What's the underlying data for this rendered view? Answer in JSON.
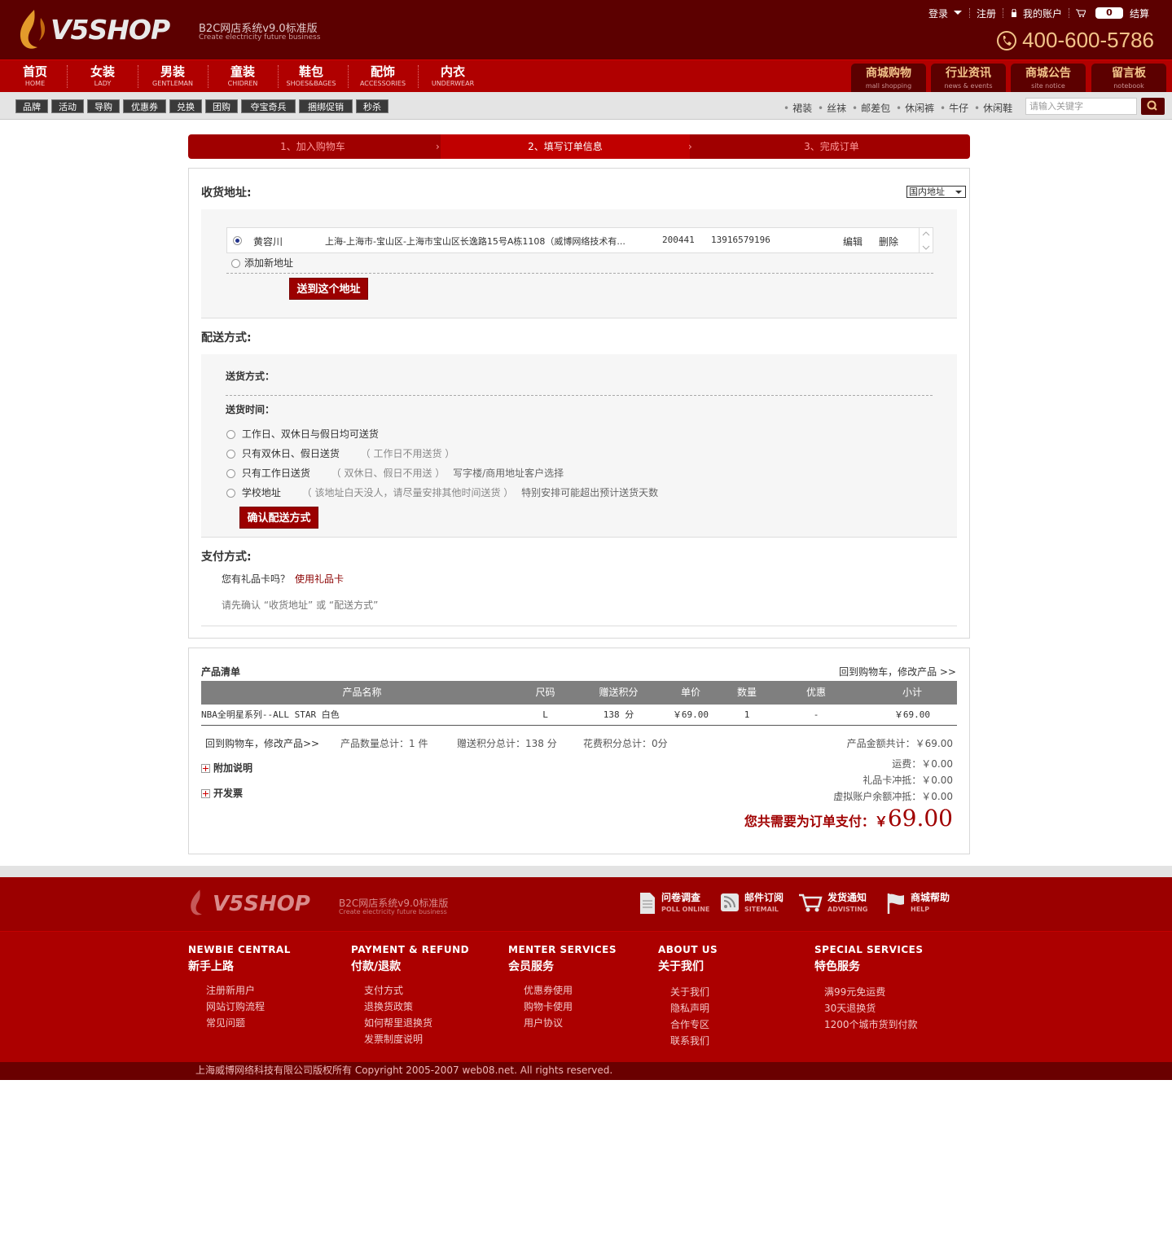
{
  "header": {
    "logo_text": "V5SHOP",
    "logo_sub_cn": "B2C网店系统v9.0标准版",
    "logo_sub_en": "Create electricity future business",
    "login": "登录",
    "register": "注册",
    "my_account": "我的账户",
    "cart_count": "0",
    "checkout": "结算",
    "phone": "400-600-5786"
  },
  "nav": {
    "items": [
      {
        "cn": "首页",
        "en": "HOME"
      },
      {
        "cn": "女装",
        "en": "LADY"
      },
      {
        "cn": "男装",
        "en": "GENTLEMAN"
      },
      {
        "cn": "童装",
        "en": "CHIDREN"
      },
      {
        "cn": "鞋包",
        "en": "SHOES&BAGES"
      },
      {
        "cn": "配饰",
        "en": "ACCESSORIES"
      },
      {
        "cn": "内衣",
        "en": "UNDERWEAR"
      }
    ],
    "right": [
      {
        "cn": "商城购物",
        "en": "mall shopping"
      },
      {
        "cn": "行业资讯",
        "en": "news & events"
      },
      {
        "cn": "商城公告",
        "en": "site notice"
      },
      {
        "cn": "留言板",
        "en": "notebook"
      }
    ]
  },
  "subbar": {
    "tags": [
      "品牌",
      "活动",
      "导购",
      "优惠券",
      "兑换",
      "团购",
      "夺宝奇兵",
      "捆绑促销",
      "秒杀"
    ],
    "hot": [
      "裙装",
      "丝袜",
      "邮差包",
      "休闲裤",
      "牛仔",
      "休闲鞋"
    ],
    "search_placeholder": "请输入关键字"
  },
  "steps": [
    "1、加入购物车",
    "2、填写订单信息",
    "3、完成订单"
  ],
  "address": {
    "title": "收货地址:",
    "select_value": "国内地址",
    "row": {
      "name": "黄容川",
      "addr": "上海-上海市-宝山区-上海市宝山区长逸路15号A栋1108（威博网络技术有...",
      "zip": "200441",
      "phone": "13916579196",
      "edit": "编辑",
      "delete": "删除"
    },
    "add_new": "添加新地址",
    "send_btn": "送到这个地址"
  },
  "delivery": {
    "title": "配送方式:",
    "method_label": "送货方式：",
    "time_label": "送货时间：",
    "options": [
      {
        "label": "工作日、双休日与假日均可送货",
        "note": "",
        "extra": ""
      },
      {
        "label": "只有双休日、假日送货",
        "note": "（ 工作日不用送货 ）",
        "extra": ""
      },
      {
        "label": "只有工作日送货",
        "note": "（ 双休日、假日不用送 ）",
        "extra": "写字楼/商用地址客户选择"
      },
      {
        "label": "学校地址",
        "note": "（ 该地址白天没人，请尽量安排其他时间送货 ）",
        "extra": "特别安排可能超出预计送货天数"
      }
    ],
    "confirm_btn": "确认配送方式"
  },
  "payment": {
    "title": "支付方式:",
    "gift_q": "您有礼品卡吗？",
    "gift_link": "使用礼品卡",
    "hint": "请先确认 “收货地址” 或 “配送方式”"
  },
  "products": {
    "title": "产品清单",
    "back_link": "回到购物车，修改产品 >>",
    "columns": [
      "产品名称",
      "尺码",
      "赠送积分",
      "单价",
      "数量",
      "优惠",
      "小计"
    ],
    "rows": [
      {
        "name": "NBA全明星系列--ALL STAR 白色",
        "size": "L",
        "points": "138 分",
        "price": "￥69.00",
        "qty": "1",
        "discount": "-",
        "subtotal": "￥69.00"
      }
    ],
    "summary": {
      "back": "回到购物车，修改产品>>",
      "count": "产品数量总计：1 件",
      "gift_points": "赠送积分总计：138 分",
      "spent_points": "花费积分总计：0分",
      "amount": "产品金额共计：￥69.00"
    },
    "attach": "附加说明",
    "invoice": "开发票",
    "fees": [
      "运费：￥0.00",
      "礼品卡冲抵：￥0.00",
      "虚拟账户余额冲抵：￥0.00"
    ],
    "total_label": "您共需要为订单支付：￥",
    "total_value": "69.00"
  },
  "footer": {
    "logo_text": "V5SHOP",
    "logo_sub_cn": "B2C网店系统v9.0标准版",
    "logo_sub_en": "Create electricity future business",
    "icons": [
      {
        "cn": "问卷调查",
        "en": "POLL ONLINE"
      },
      {
        "cn": "邮件订阅",
        "en": "SITEMAIL"
      },
      {
        "cn": "发货通知",
        "en": "ADVISTING"
      },
      {
        "cn": "商城帮助",
        "en": "HELP"
      }
    ],
    "columns": [
      {
        "en": "NEWBIE CENTRAL",
        "cn": "新手上路",
        "links": [
          "注册新用户",
          "网站订购流程",
          "常见问题"
        ]
      },
      {
        "en": "PAYMENT & REFUND",
        "cn": "付款/退款",
        "links": [
          "支付方式",
          "退换货政策",
          "如何帮里退换货",
          "发票制度说明"
        ]
      },
      {
        "en": "MENTER SERVICES",
        "cn": "会员服务",
        "links": [
          "优惠券使用",
          "购物卡使用",
          "用户协议"
        ]
      },
      {
        "en": "ABOUT US",
        "cn": "关于我们",
        "links": [
          "关于我们",
          "隐私声明",
          "合作专区",
          "联系我们"
        ]
      },
      {
        "en": "SPECIAL SERVICES",
        "cn": "特色服务",
        "links": [
          "满99元免运费",
          "30天退换货",
          "1200个城市货到付款"
        ]
      }
    ],
    "copyright": "上海威博网络科技有限公司版权所有  Copyright 2005-2007 web08.net. All rights reserved."
  }
}
